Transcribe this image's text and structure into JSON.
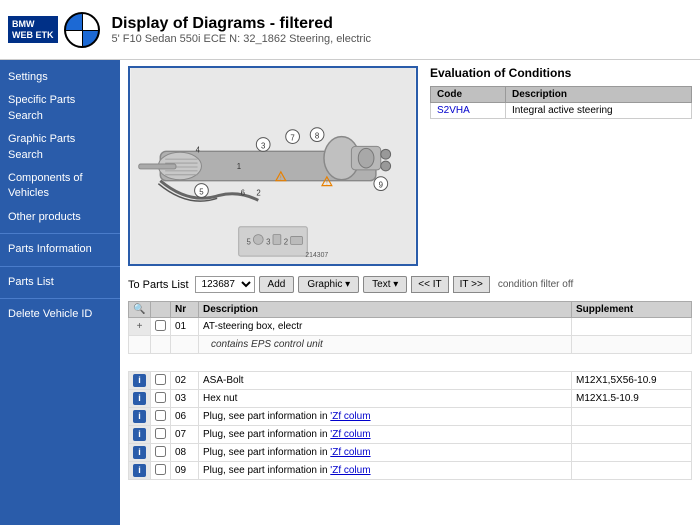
{
  "header": {
    "title": "Display of Diagrams - filtered",
    "subtitle": "5' F10 Sedan 550i ECE N: 32_1862 Steering, electric"
  },
  "sidebar": {
    "items": [
      {
        "id": "settings",
        "label": "Settings"
      },
      {
        "id": "specific-parts-search",
        "label": "Specific Parts Search"
      },
      {
        "id": "graphic-parts-search",
        "label": "Graphic Parts Search"
      },
      {
        "id": "components-of-vehicles",
        "label": "Components of Vehicles"
      },
      {
        "id": "other-products",
        "label": "Other products"
      },
      {
        "id": "parts-information",
        "label": "Parts Information"
      },
      {
        "id": "parts-list",
        "label": "Parts List"
      },
      {
        "id": "delete-vehicle-id",
        "label": "Delete Vehicle ID"
      }
    ]
  },
  "evaluation": {
    "title": "Evaluation of Conditions",
    "table_headers": [
      "Code",
      "Description"
    ],
    "rows": [
      {
        "code": "S2VHA",
        "description": "Integral active steering"
      }
    ]
  },
  "toolbar": {
    "to_parts_list_label": "To Parts List",
    "parts_list_value": "123687",
    "add_label": "Add",
    "graphic_label": "Graphic ▾",
    "text_label": "Text ▾",
    "nav_prev": "<< IT",
    "nav_next": "IT >>",
    "condition_label": "condition filter off"
  },
  "parts_table": {
    "headers": [
      "",
      "",
      "Nr",
      "Description",
      "Supplement"
    ],
    "rows": [
      {
        "nr": "01",
        "has_info": false,
        "has_plus": true,
        "description": "AT-steering box, electr",
        "supplement": "",
        "sub": "contains EPS control unit"
      },
      {
        "nr": "02",
        "has_info": true,
        "description": "ASA-Bolt",
        "supplement": "M12X1,5X56-10.9"
      },
      {
        "nr": "03",
        "has_info": true,
        "description": "Hex nut",
        "supplement": "M12X1.5-10.9"
      },
      {
        "nr": "06",
        "has_info": true,
        "description": "Plug, see part information in 'Zf colum",
        "supplement": "",
        "is_link": true
      },
      {
        "nr": "07",
        "has_info": true,
        "description": "Plug, see part information in 'Zf colum",
        "supplement": "",
        "is_link": true
      },
      {
        "nr": "08",
        "has_info": true,
        "description": "Plug, see part information in 'Zf colum",
        "supplement": "",
        "is_link": true
      },
      {
        "nr": "09",
        "has_info": true,
        "description": "Plug, see part information in 'Zf colum",
        "supplement": "",
        "is_link": true
      }
    ]
  },
  "icons": {
    "info": "i",
    "search": "🔍"
  }
}
